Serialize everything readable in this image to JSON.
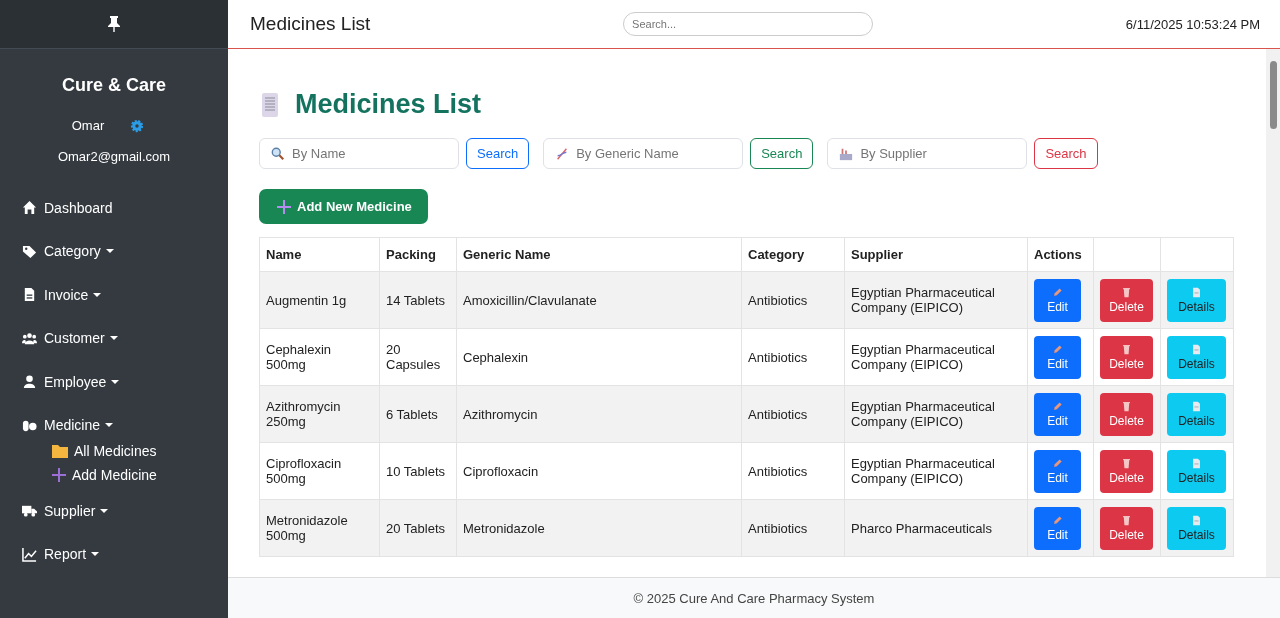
{
  "sidebar": {
    "brand": "Cure & Care",
    "user": {
      "name": "Omar",
      "email": "Omar2@gmail.com"
    },
    "items": [
      {
        "label": "Dashboard",
        "kind": "link"
      },
      {
        "label": "Category",
        "kind": "dropdown"
      },
      {
        "label": "Invoice",
        "kind": "dropdown"
      },
      {
        "label": "Customer",
        "kind": "dropdown"
      },
      {
        "label": "Employee",
        "kind": "dropdown"
      },
      {
        "label": "Medicine",
        "kind": "dropdown",
        "expanded": true,
        "children": [
          {
            "label": "All Medicines"
          },
          {
            "label": "Add Medicine"
          }
        ]
      },
      {
        "label": "Supplier",
        "kind": "dropdown"
      },
      {
        "label": "Report",
        "kind": "dropdown"
      }
    ]
  },
  "topbar": {
    "title": "Medicines List",
    "search": {
      "placeholder": "Search..."
    },
    "datetime": "6/11/2025 10:53:24 PM"
  },
  "page": {
    "heading": "Medicines List",
    "filters": [
      {
        "placeholder": "By Name",
        "button": "Search",
        "color": "#0d6efd"
      },
      {
        "placeholder": "By Generic Name",
        "button": "Search",
        "color": "#198754"
      },
      {
        "placeholder": "By Supplier",
        "button": "Search",
        "color": "#dc3545"
      }
    ],
    "add_button": "Add New Medicine",
    "table": {
      "columns": [
        "Name",
        "Packing",
        "Generic Name",
        "Category",
        "Supplier",
        "Actions"
      ],
      "rows": [
        {
          "cells": [
            "Augmentin 1g",
            "14 Tablets",
            "Amoxicillin/Clavulanate",
            "Antibiotics",
            "Egyptian Pharmaceutical Company (EIPICO)"
          ],
          "actions": [
            {
              "kind": "edit",
              "label": "Edit"
            },
            {
              "kind": "delete",
              "label": "Delete"
            },
            {
              "kind": "details",
              "label": "Details"
            }
          ]
        },
        {
          "cells": [
            "Cephalexin 500mg",
            "20 Capsules",
            "Cephalexin",
            "Antibiotics",
            "Egyptian Pharmaceutical Company (EIPICO)"
          ],
          "actions": [
            {
              "kind": "edit",
              "label": "Edit"
            },
            {
              "kind": "delete",
              "label": "Delete"
            },
            {
              "kind": "details",
              "label": "Details"
            }
          ]
        },
        {
          "cells": [
            "Azithromycin 250mg",
            "6 Tablets",
            "Azithromycin",
            "Antibiotics",
            "Egyptian Pharmaceutical Company (EIPICO)"
          ],
          "actions": [
            {
              "kind": "edit",
              "label": "Edit"
            },
            {
              "kind": "delete",
              "label": "Delete"
            },
            {
              "kind": "details",
              "label": "Details"
            }
          ]
        },
        {
          "cells": [
            "Ciprofloxacin 500mg",
            "10 Tablets",
            "Ciprofloxacin",
            "Antibiotics",
            "Egyptian Pharmaceutical Company (EIPICO)"
          ],
          "actions": [
            {
              "kind": "edit",
              "label": "Edit"
            },
            {
              "kind": "delete",
              "label": "Delete"
            },
            {
              "kind": "details",
              "label": "Details"
            }
          ]
        },
        {
          "cells": [
            "Metronidazole 500mg",
            "20 Tablets",
            "Metronidazole",
            "Antibiotics",
            "Pharco Pharmaceuticals"
          ],
          "actions": [
            {
              "kind": "edit",
              "label": "Edit"
            },
            {
              "kind": "delete",
              "label": "Delete"
            },
            {
              "kind": "details",
              "label": "Details"
            }
          ]
        }
      ]
    }
  },
  "footer": "© 2025 Cure And Care Pharmacy System"
}
